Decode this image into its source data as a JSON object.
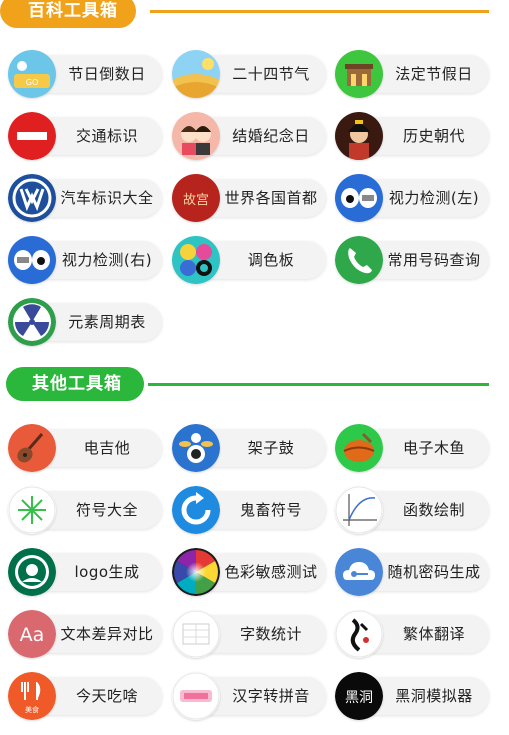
{
  "sections": [
    {
      "title": "百科工具箱",
      "tools": [
        {
          "label": "节日倒数日",
          "icon": "festival-countdown-icon"
        },
        {
          "label": "二十四节气",
          "icon": "solar-terms-icon"
        },
        {
          "label": "法定节假日",
          "icon": "legal-holiday-icon"
        },
        {
          "label": "交通标识",
          "icon": "no-entry-sign-icon"
        },
        {
          "label": "结婚纪念日",
          "icon": "wedding-anniversary-icon"
        },
        {
          "label": "历史朝代",
          "icon": "history-dynasty-icon"
        },
        {
          "label": "汽车标识大全",
          "icon": "car-logo-icon"
        },
        {
          "label": "世界各国首都",
          "icon": "world-capitals-icon"
        },
        {
          "label": "视力检测(左)",
          "icon": "eye-test-left-icon"
        },
        {
          "label": "视力检测(右)",
          "icon": "eye-test-right-icon"
        },
        {
          "label": "调色板",
          "icon": "palette-icon"
        },
        {
          "label": "常用号码查询",
          "icon": "phone-icon"
        },
        {
          "label": "元素周期表",
          "icon": "radiation-icon"
        }
      ]
    },
    {
      "title": "其他工具箱",
      "tools": [
        {
          "label": "电吉他",
          "icon": "guitar-icon"
        },
        {
          "label": "架子鼓",
          "icon": "drum-kit-icon"
        },
        {
          "label": "电子木鱼",
          "icon": "wooden-fish-icon"
        },
        {
          "label": "符号大全",
          "icon": "symbol-star-icon"
        },
        {
          "label": "鬼畜符号",
          "icon": "refresh-symbol-icon"
        },
        {
          "label": "函数绘制",
          "icon": "function-graph-icon"
        },
        {
          "label": "logo生成",
          "icon": "logo-maker-icon"
        },
        {
          "label": "色彩敏感测试",
          "icon": "color-wheel-icon"
        },
        {
          "label": "随机密码生成",
          "icon": "cloud-key-icon"
        },
        {
          "label": "文本差异对比",
          "icon": "text-diff-icon"
        },
        {
          "label": "字数统计",
          "icon": "word-count-icon"
        },
        {
          "label": "繁体翻译",
          "icon": "traditional-chinese-icon"
        },
        {
          "label": "今天吃啥",
          "icon": "food-icon"
        },
        {
          "label": "汉字转拼音",
          "icon": "pinyin-icon"
        },
        {
          "label": "黑洞模拟器",
          "icon": "black-hole-icon"
        }
      ]
    }
  ],
  "icon_text": {
    "aa": "Aa",
    "diff_badge": "美食",
    "gallery": "故宫",
    "black_hole": "黑洞"
  }
}
